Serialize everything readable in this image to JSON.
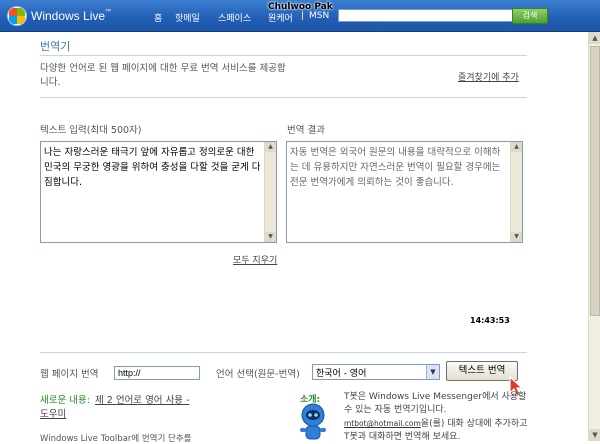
{
  "header": {
    "brand": "Windows Live",
    "brand_tm": "™",
    "nav": [
      "홈",
      "핫메일",
      "스페이스",
      "원케어",
      "|",
      "MSN"
    ],
    "user": "Chulwoo Pak",
    "search_value": "",
    "search_button": "검색"
  },
  "page": {
    "title": "번역기",
    "description": "다양한 언어로 된 웹 페이지에 대한 무료 번역 서비스를 제공합니다.",
    "favorite_link": "즐겨찾기에 추가",
    "input_label": "텍스트 입력(최대 500자)",
    "input_text": "나는 자랑스러운 태극기 앞에 자유롭고 정의로운 대한민국의 무궁한 영광을 위하여 충성을 다할 것을 굳게 다짐합니다.",
    "output_label": "번역 결과",
    "output_text": "자동 번역은 외국어 원문의 내용을 대략적으로 이해하는 데 유용하지만 자연스러운 번역이 필요할 경우에는 전문 번역가에게 의뢰하는 것이 좋습니다.",
    "clear_all": "모두 지우기",
    "clock": "14:43:53"
  },
  "webpage": {
    "label": "웹 페이지 번역",
    "url_value": "http://",
    "lang_label": "언어 선택(원문-번역)",
    "lang_selected": "한국어 - 영어",
    "translate_button": "텍스트 번역"
  },
  "news": {
    "label": "새로운 내용:",
    "link": "제 2 언어로 영어 사용 -",
    "help": "도우미",
    "toolbar_note": "Windows Live Toolbar에 번역기 단추를"
  },
  "intro": {
    "label": "소개:",
    "line1": "T봇은 Windows Live Messenger에서 사용할 수 있는 자동 번역기입니다.",
    "mail": "mtbot@hotmail.com",
    "line2": "을(를) 대화 상대에 추가하고 T봇과 대화하면 번역해 보세요."
  },
  "colors": {
    "header_blue": "#215eb4",
    "title_blue": "#3e76b4",
    "accent_green": "#2a8a2a"
  }
}
